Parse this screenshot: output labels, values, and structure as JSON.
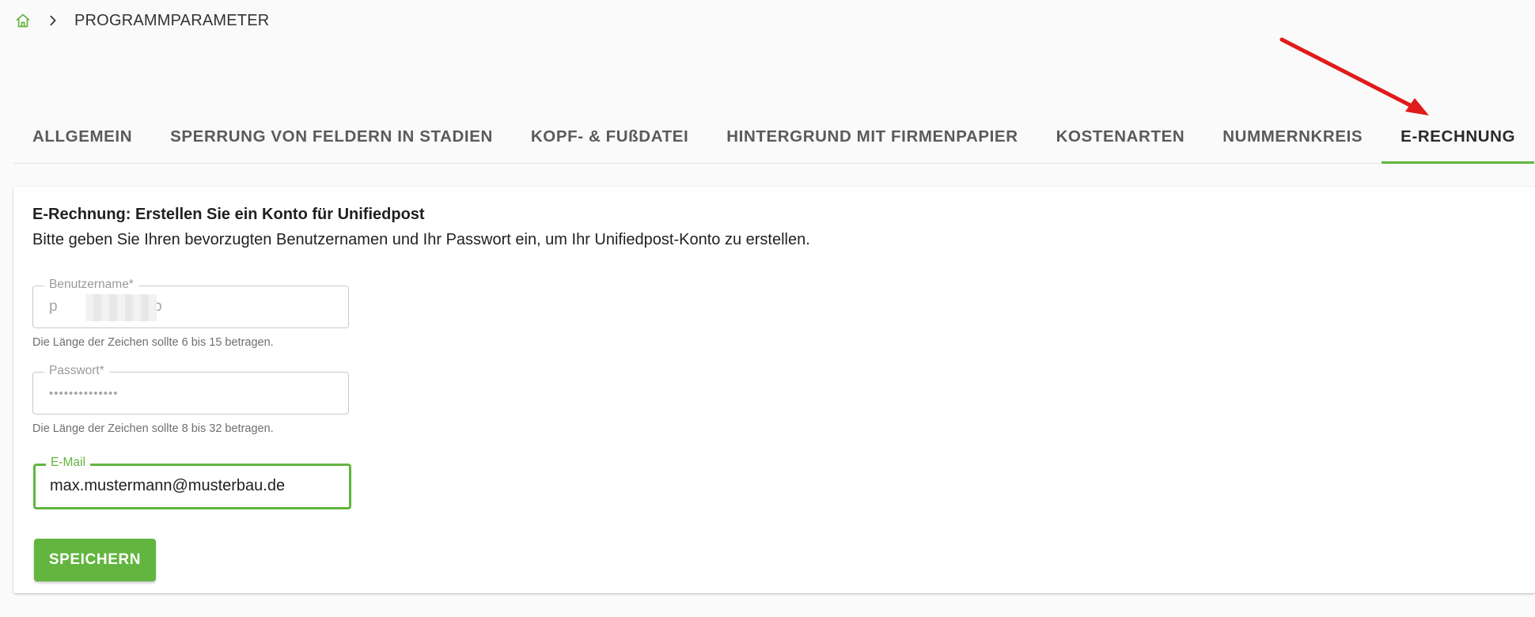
{
  "breadcrumb": {
    "home_icon": "home-icon",
    "separator_icon": "chevron-right-icon",
    "title": "PROGRAMMPARAMETER"
  },
  "tabs": [
    {
      "label": "ALLGEMEIN",
      "active": false
    },
    {
      "label": "SPERRUNG VON FELDERN IN STADIEN",
      "active": false
    },
    {
      "label": "KOPF- & FUßDATEI",
      "active": false
    },
    {
      "label": "HINTERGRUND MIT FIRMENPAPIER",
      "active": false
    },
    {
      "label": "KOSTENARTEN",
      "active": false
    },
    {
      "label": "NUMMERNKREIS",
      "active": false
    },
    {
      "label": "E-RECHNUNG",
      "active": true
    }
  ],
  "card": {
    "title": "E-Rechnung: Erstellen Sie ein Konto für Unifiedpost",
    "description": "Bitte geben Sie Ihren bevorzugten Benutzernamen und Ihr Passwort ein, um Ihr Unifiedpost-Konto zu erstellen.",
    "username": {
      "label": "Benutzername*",
      "value_start": "p",
      "value_end": "b",
      "hint": "Die Länge der Zeichen sollte 6 bis 15 betragen."
    },
    "password": {
      "label": "Passwort*",
      "value": "••••••••••••••",
      "hint": "Die Länge der Zeichen sollte 8 bis 32 betragen."
    },
    "email": {
      "label": "E-Mail",
      "value": "max.mustermann@musterbau.de"
    },
    "save_label": "SPEICHERN"
  },
  "colors": {
    "accent": "#62b53f",
    "annotation_arrow": "#e01b1b"
  }
}
